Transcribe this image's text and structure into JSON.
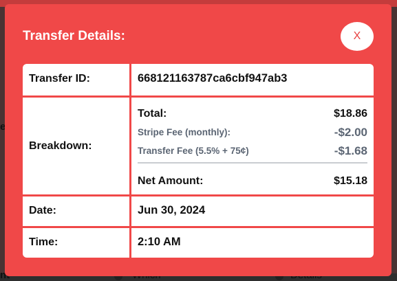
{
  "modal": {
    "title": "Transfer Details:",
    "close_label": "X"
  },
  "transfer_id": {
    "label": "Transfer ID:",
    "value": "668121163787ca6cbf947ab3"
  },
  "breakdown": {
    "label": "Breakdown:",
    "total_label": "Total:",
    "total_value": "$18.86",
    "stripe_fee_label": "Stripe Fee (monthly):",
    "stripe_fee_value": "-$2.00",
    "transfer_fee_label": "Transfer Fee (5.5% + 75¢)",
    "transfer_fee_value": "-$1.68",
    "net_label": "Net Amount:",
    "net_value": "$15.18"
  },
  "date": {
    "label": "Date:",
    "value": "Jun 30, 2024"
  },
  "time": {
    "label": "Time:",
    "value": "2:10 AM"
  },
  "background": {
    "left_fragment": "e",
    "bottom_left_fragment": "nt",
    "bottom_mid_fragment": "Which",
    "bottom_right_fragment": "Details"
  }
}
